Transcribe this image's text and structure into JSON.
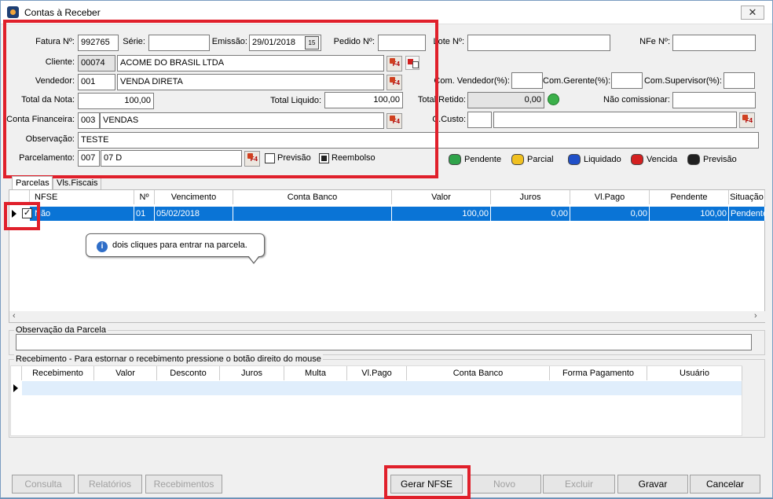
{
  "window": {
    "title": "Contas à Receber",
    "close": "✕"
  },
  "form": {
    "fatura_label": "Fatura Nº:",
    "fatura": "992765",
    "serie_label": "Série:",
    "serie": "",
    "emissao_label": "Emissão:",
    "emissao": "29/01/2018",
    "cal": "15",
    "pedido_label": "Pedido Nº:",
    "pedido": "",
    "lote_label": "Lote Nº:",
    "lote": "",
    "nfe_label": "NFe Nº:",
    "nfe": "",
    "cliente_label": "Cliente:",
    "cliente_code": "00074",
    "cliente_name": "ACOME DO BRASIL LTDA",
    "vendedor_label": "Vendedor:",
    "vendedor_code": "001",
    "vendedor_name": "VENDA DIRETA",
    "com_vendedor_label": "Com. Vendedor(%):",
    "com_gerente_label": "Com.Gerente(%):",
    "com_supervisor_label": "Com.Supervisor(%):",
    "total_nota_label": "Total da Nota:",
    "total_nota": "100,00",
    "total_liquido_label": "Total Liquido:",
    "total_liquido": "100,00",
    "total_retido_label": "Total Retido:",
    "total_retido": "0,00",
    "nao_comissionar_label": "Não comissionar:",
    "conta_fin_label": "Conta Financeira:",
    "conta_fin_code": "003",
    "conta_fin_name": "VENDAS",
    "ccusto_label": "C.Custo:",
    "observacao_label": "Observação:",
    "observacao": "TESTE",
    "parcelamento_label": "Parcelamento:",
    "parc_code": "007",
    "parc_name": "07 D",
    "previsao_label": "Previsão",
    "reembolso_label": "Reembolso",
    "f4": "F4"
  },
  "legend": [
    {
      "label": "Pendente",
      "color": "#2fa34a"
    },
    {
      "label": "Parcial",
      "color": "#f0c020"
    },
    {
      "label": "Liquidado",
      "color": "#2050c8"
    },
    {
      "label": "Vencida",
      "color": "#d42020"
    },
    {
      "label": "Previsão",
      "color": "#202020"
    }
  ],
  "tabs": [
    "Parcelas",
    "Vls.Fiscais"
  ],
  "parcelas": {
    "headers": [
      "NFSE",
      "Nº",
      "Vencimento",
      "Conta Banco",
      "Valor",
      "Juros",
      "Vl.Pago",
      "Pendente",
      "Situação"
    ],
    "rows": [
      [
        "Não",
        "01",
        "05/02/2018",
        "",
        "100,00",
        "0,00",
        "0,00",
        "100,00",
        "Pendente"
      ]
    ],
    "selected_color": "#0a74d6"
  },
  "tooltip": {
    "text": "dois cliques para entrar na parcela."
  },
  "obs_parcela": {
    "title": "Observação da Parcela",
    "value": ""
  },
  "recebimento": {
    "title": "Recebimento - Para estornar o recebimento pressione o botão direito do mouse",
    "headers": [
      "Recebimento",
      "Valor",
      "Desconto",
      "Juros",
      "Multa",
      "Vl.Pago",
      "Conta Banco",
      "Forma Pagamento",
      "Usuário"
    ]
  },
  "buttons": {
    "consulta": "Consulta",
    "relatorios": "Relatórios",
    "recebimentos": "Recebimentos",
    "gerar_nfse": "Gerar NFSE",
    "novo": "Novo",
    "excluir": "Excluir",
    "gravar": "Gravar",
    "cancelar": "Cancelar"
  }
}
